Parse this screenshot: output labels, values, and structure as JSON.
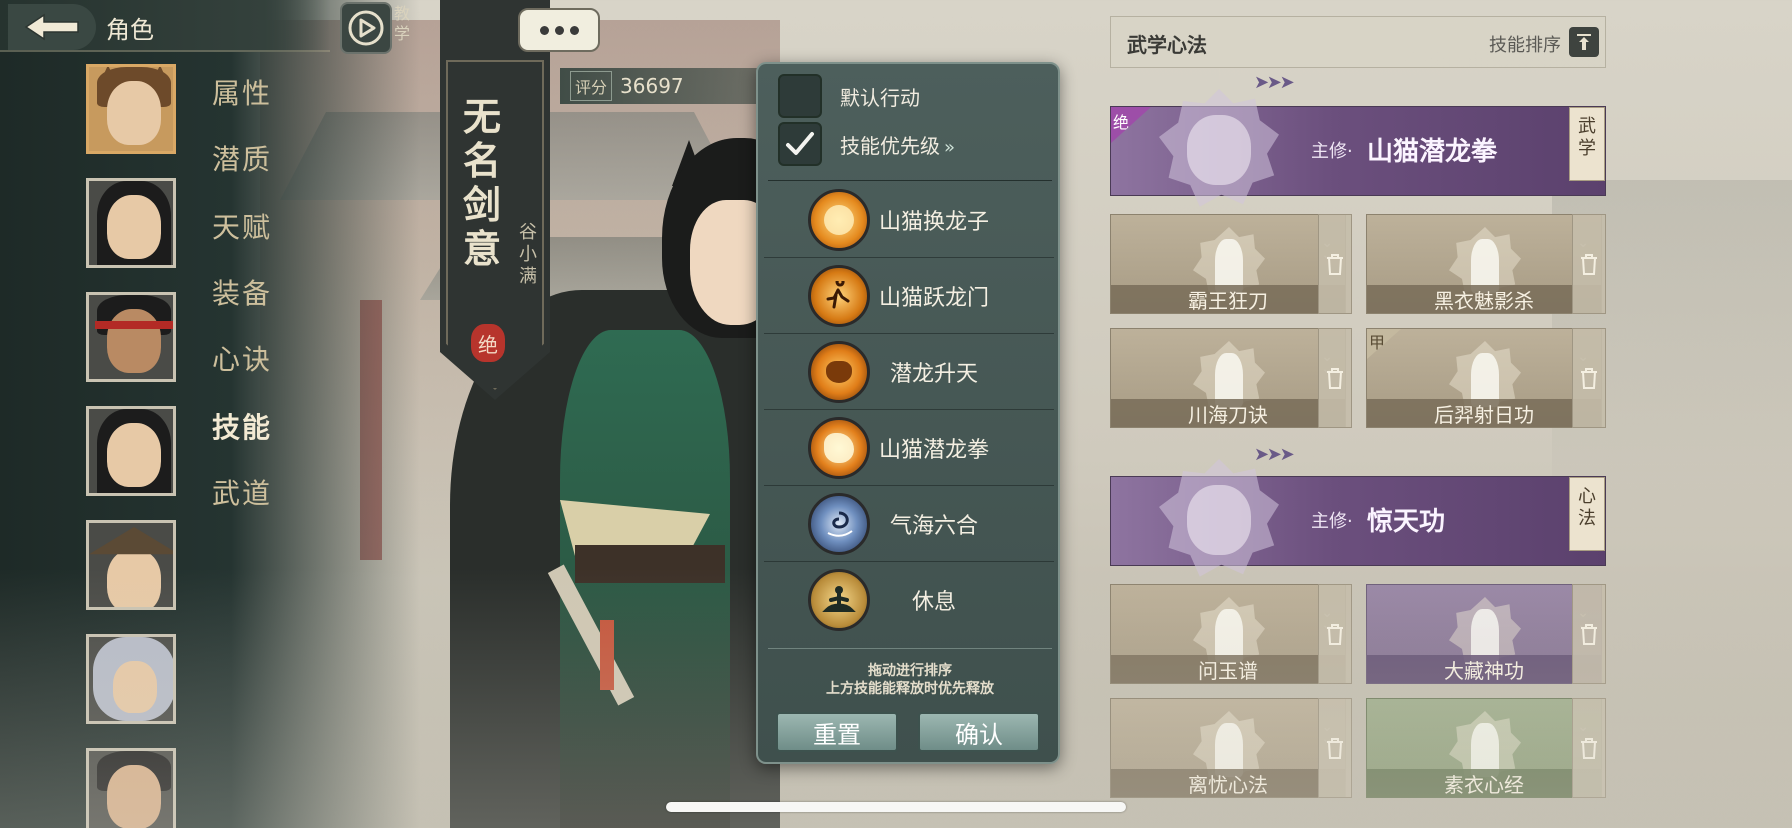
{
  "header": {
    "title": "角色",
    "tutorial_label": "教学"
  },
  "nav": {
    "items": [
      {
        "label": "属性",
        "active": false
      },
      {
        "label": "潜质",
        "active": false
      },
      {
        "label": "天赋",
        "active": false
      },
      {
        "label": "装备",
        "active": false
      },
      {
        "label": "心诀",
        "active": false
      },
      {
        "label": "技能",
        "active": true
      },
      {
        "label": "武道",
        "active": false
      }
    ]
  },
  "character": {
    "title": "无名剑意",
    "name": "谷小满",
    "seal": "绝",
    "score_label": "评分",
    "score_value": "36697"
  },
  "popup": {
    "default_action_label": "默认行动",
    "default_action_checked": false,
    "priority_label": "技能优先级",
    "priority_checked": true,
    "skills": [
      {
        "label": "山猫换龙子",
        "icon": "fire-burst-icon",
        "color": "#e58a1e"
      },
      {
        "label": "山猫跃龙门",
        "icon": "running-figure-icon",
        "color": "#d67a14"
      },
      {
        "label": "潜龙升天",
        "icon": "dragon-head-icon",
        "color": "#e07d18"
      },
      {
        "label": "山猫潜龙拳",
        "icon": "flame-fist-icon",
        "color": "#e3801c"
      },
      {
        "label": "气海六合",
        "icon": "swirl-icon",
        "color": "#2c4a7e"
      },
      {
        "label": "休息",
        "icon": "meditation-icon",
        "color": "#3f5a48"
      }
    ],
    "hint_line1": "拖动进行排序",
    "hint_line2": "上方技能能释放时优先释放",
    "reset_label": "重置",
    "confirm_label": "确认"
  },
  "right_panel": {
    "title": "武学心法",
    "sort_label": "技能排序",
    "sections": [
      {
        "main_prefix": "主修·",
        "main_name": "山猫潜龙拳",
        "corner_tag": "绝",
        "side_tab": "武学",
        "cards": [
          {
            "name": "霸王狂刀",
            "tag": ""
          },
          {
            "name": "黑衣魅影杀",
            "tag": ""
          },
          {
            "name": "川海刀诀",
            "tag": ""
          },
          {
            "name": "后羿射日功",
            "tag": "甲"
          }
        ]
      },
      {
        "main_prefix": "主修·",
        "main_name": "惊天功",
        "corner_tag": "",
        "side_tab": "心法",
        "cards": [
          {
            "name": "问玉谱",
            "tag": ""
          },
          {
            "name": "大藏神功",
            "tag": ""
          },
          {
            "name": "离忧心法",
            "tag": ""
          },
          {
            "name": "素衣心经",
            "tag": ""
          }
        ]
      }
    ]
  },
  "colors": {
    "accent_purple": "#6b4f7d",
    "popup_bg": "#4d5f5c",
    "button_teal": "#8aa7a1"
  }
}
